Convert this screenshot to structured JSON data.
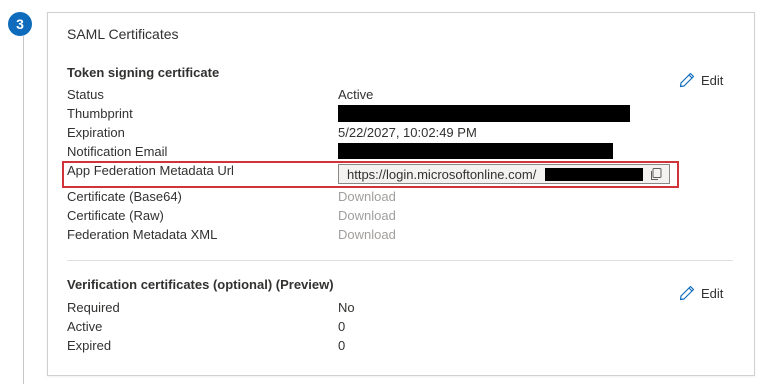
{
  "step": {
    "number": "3"
  },
  "card": {
    "title": "SAML Certificates"
  },
  "token_section": {
    "title": "Token signing certificate",
    "edit_label": "Edit",
    "rows": [
      {
        "label": "Status",
        "value": "Active"
      },
      {
        "label": "Thumbprint",
        "value": ""
      },
      {
        "label": "Expiration",
        "value": "5/22/2027, 10:02:49 PM"
      },
      {
        "label": "Notification Email",
        "value": ""
      },
      {
        "label": "App Federation Metadata Url",
        "value": "https://login.microsoftonline.com/"
      },
      {
        "label": "Certificate (Base64)",
        "value": "Download"
      },
      {
        "label": "Certificate (Raw)",
        "value": "Download"
      },
      {
        "label": "Federation Metadata XML",
        "value": "Download"
      }
    ]
  },
  "verification_section": {
    "title": "Verification certificates (optional) (Preview)",
    "edit_label": "Edit",
    "rows": [
      {
        "label": "Required",
        "value": "No"
      },
      {
        "label": "Active",
        "value": "0"
      },
      {
        "label": "Expired",
        "value": "0"
      }
    ]
  },
  "icons": {
    "edit": "pencil-icon",
    "copy": "copy-icon"
  },
  "colors": {
    "accent": "#0f6cbd",
    "highlight": "#d13438",
    "disabled_link": "#a19f9d"
  }
}
